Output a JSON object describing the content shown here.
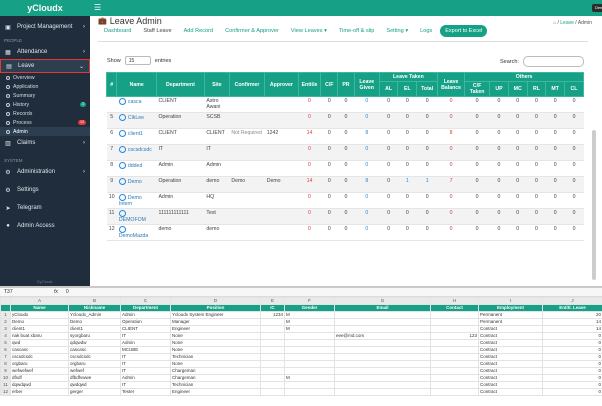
{
  "app": {
    "brand": "yCloudx",
    "top_button": "Demo"
  },
  "sidebar": {
    "items_top": [
      {
        "label": "Project Management",
        "icon": "briefcase-icon"
      }
    ],
    "section_people": "PEOPLE",
    "people": [
      {
        "label": "Attendance",
        "icon": "calendar-icon"
      },
      {
        "label": "Leave",
        "icon": "leave-icon"
      }
    ],
    "leave_sub": [
      {
        "label": "Overview"
      },
      {
        "label": "Application"
      },
      {
        "label": "Summary"
      },
      {
        "label": "History",
        "badge": "3",
        "badge_color": "#16a085"
      },
      {
        "label": "Records"
      },
      {
        "label": "Process",
        "badge": "12",
        "badge_color": "#e53935"
      },
      {
        "label": "Admin"
      }
    ],
    "claims": "Claims",
    "section_system": "SYSTEM",
    "system": [
      {
        "label": "Administration",
        "icon": "gear-icon"
      },
      {
        "label": "Settings",
        "icon": "settings-icon"
      },
      {
        "label": "Telegram",
        "icon": "telegram-icon"
      },
      {
        "label": "Admin Access",
        "icon": "user-icon"
      }
    ],
    "footer": "©yCloud."
  },
  "page": {
    "title": "Leave Admin",
    "breadcrumb": {
      "home": "⌂",
      "leave": "Leave",
      "current": "Admin"
    }
  },
  "tabs": [
    {
      "label": "Dashboard"
    },
    {
      "label": "Staff Leave"
    },
    {
      "label": "Add Record"
    },
    {
      "label": "Confirmer & Approver"
    },
    {
      "label": "View Leaves ▾"
    },
    {
      "label": "Time-off & slip"
    },
    {
      "label": "Setting ▾"
    },
    {
      "label": "Logs"
    }
  ],
  "export_label": "Export to Excel",
  "controls": {
    "show": "Show",
    "entries_value": "15",
    "entries": "entries",
    "search": "Search:"
  },
  "table": {
    "group_leave_taken": "Leave Taken",
    "group_others": "Others",
    "columns": [
      "#",
      "Name",
      "Department",
      "Site",
      "Confirmer",
      "Approver",
      "Entitle",
      "C/F",
      "PR",
      "Leave Given",
      "AL",
      "EL",
      "Total",
      "Leave Balance",
      "C/F Taken",
      "UP",
      "MC",
      "RL",
      "MT",
      "CL"
    ],
    "rows": [
      [
        "",
        "casca",
        "CLIENT",
        "Astro Awani",
        "",
        "",
        "0",
        "0",
        "0",
        "0",
        "0",
        "0",
        "0",
        "0",
        "0",
        "0",
        "0",
        "0",
        "0",
        "0"
      ],
      [
        "5",
        "ClkLee",
        "Operation",
        "SCSB",
        "",
        "",
        "0",
        "0",
        "0",
        "0",
        "0",
        "0",
        "0",
        "0",
        "0",
        "0",
        "0",
        "0",
        "0",
        "0"
      ],
      [
        "6",
        "client1",
        "CLIENT",
        "CLIENT",
        "Not Required",
        "1242",
        "14",
        "0",
        "0",
        "8",
        "0",
        "0",
        "0",
        "8",
        "0",
        "0",
        "0",
        "0",
        "0",
        "0"
      ],
      [
        "7",
        "cscsdcsdc",
        "IT",
        "IT",
        "",
        "",
        "0",
        "0",
        "0",
        "0",
        "0",
        "0",
        "0",
        "0",
        "0",
        "0",
        "0",
        "0",
        "0",
        "0"
      ],
      [
        "8",
        "ddded",
        "Admin",
        "Admin",
        "",
        "",
        "0",
        "0",
        "0",
        "0",
        "0",
        "0",
        "0",
        "0",
        "0",
        "0",
        "0",
        "0",
        "0",
        "0"
      ],
      [
        "9",
        "Demo",
        "Operation",
        "demo",
        "Demo",
        "Demo",
        "14",
        "0",
        "0",
        "8",
        "0",
        "1",
        "1",
        "7",
        "0",
        "0",
        "0",
        "0",
        "0",
        "0"
      ],
      [
        "10",
        "Demo Intern",
        "Admin",
        "HQ",
        "",
        "",
        "0",
        "0",
        "0",
        "0",
        "0",
        "0",
        "0",
        "0",
        "0",
        "0",
        "0",
        "0",
        "0",
        "0"
      ],
      [
        "11",
        "DEMOFOM",
        "111111111111",
        "Test",
        "",
        "",
        "0",
        "0",
        "0",
        "0",
        "0",
        "0",
        "0",
        "0",
        "0",
        "0",
        "0",
        "0",
        "0",
        "0"
      ],
      [
        "12",
        "DemoMazda",
        "demo",
        "demo",
        "",
        "",
        "0",
        "0",
        "0",
        "0",
        "0",
        "0",
        "0",
        "0",
        "0",
        "0",
        "0",
        "0",
        "0",
        "0"
      ]
    ]
  },
  "excel": {
    "cell_ref": "T37",
    "fx": "fx",
    "formula_value": "0",
    "col_letters": [
      "",
      "A",
      "B",
      "C",
      "D",
      "E",
      "F",
      "G",
      "H",
      "I",
      "J"
    ],
    "headers": [
      "Name",
      "Nickname",
      "Department",
      "Position",
      "IC",
      "Gender",
      "Email",
      "Contact",
      "Employment",
      "Entitl. Leave"
    ],
    "rows": [
      [
        "1",
        "yCloudx",
        "Ycloudx_Admin",
        "Admin",
        "Ycloudx System Engineer",
        "1234",
        "M",
        "",
        "",
        "Permanent",
        "20"
      ],
      [
        "2",
        "Demo",
        "Demo",
        "Operation",
        "Manager",
        "",
        "M",
        "",
        "",
        "Permanent",
        "14"
      ],
      [
        "3",
        "client1",
        "client1",
        "CLIENT",
        "Engineer",
        "",
        "M",
        "",
        "",
        "Contract",
        "14"
      ],
      [
        "4",
        "nak buat xbaru",
        "syorgbaru",
        "IT",
        "None",
        "",
        "",
        "eee@md.com",
        "123",
        "Contract",
        "0"
      ],
      [
        "5",
        "qwd",
        "qdqwdw",
        "Admin",
        "None",
        "",
        "",
        "",
        "",
        "Contract",
        "0"
      ],
      [
        "6",
        "cascasc",
        "cascasc",
        "MCUBE",
        "None",
        "",
        "",
        "",
        "",
        "Contract",
        "0"
      ],
      [
        "7",
        "cscsdcsdc",
        "cscsdcsdc",
        "IT",
        "Technician",
        "",
        "",
        "",
        "",
        "Contract",
        "0"
      ],
      [
        "8",
        "orgbaru",
        "orgbaru",
        "IT",
        "None",
        "",
        "",
        "",
        "",
        "Contract",
        "0"
      ],
      [
        "9",
        "wefwefwef",
        "wefwef",
        "IT",
        "Chargeman",
        "",
        "",
        "",
        "",
        "Contract",
        "0"
      ],
      [
        "10",
        "dfsdf",
        "dfbdfvwwe",
        "Admin",
        "Chargeman",
        "",
        "M",
        "",
        "",
        "Contract",
        "0"
      ],
      [
        "11",
        "dqwdqwd",
        "qwdqwd",
        "IT",
        "Technician",
        "",
        "",
        "",
        "",
        "Contract",
        "0"
      ],
      [
        "12",
        "erber",
        "gerger",
        "Tester",
        "Engineer",
        "",
        "",
        "",
        "",
        "Contract",
        "0"
      ]
    ]
  },
  "colors": {
    "accent": "#16a085",
    "sidebar": "#1f2d3d",
    "danger": "#e53935",
    "link": "#1e88e5"
  }
}
